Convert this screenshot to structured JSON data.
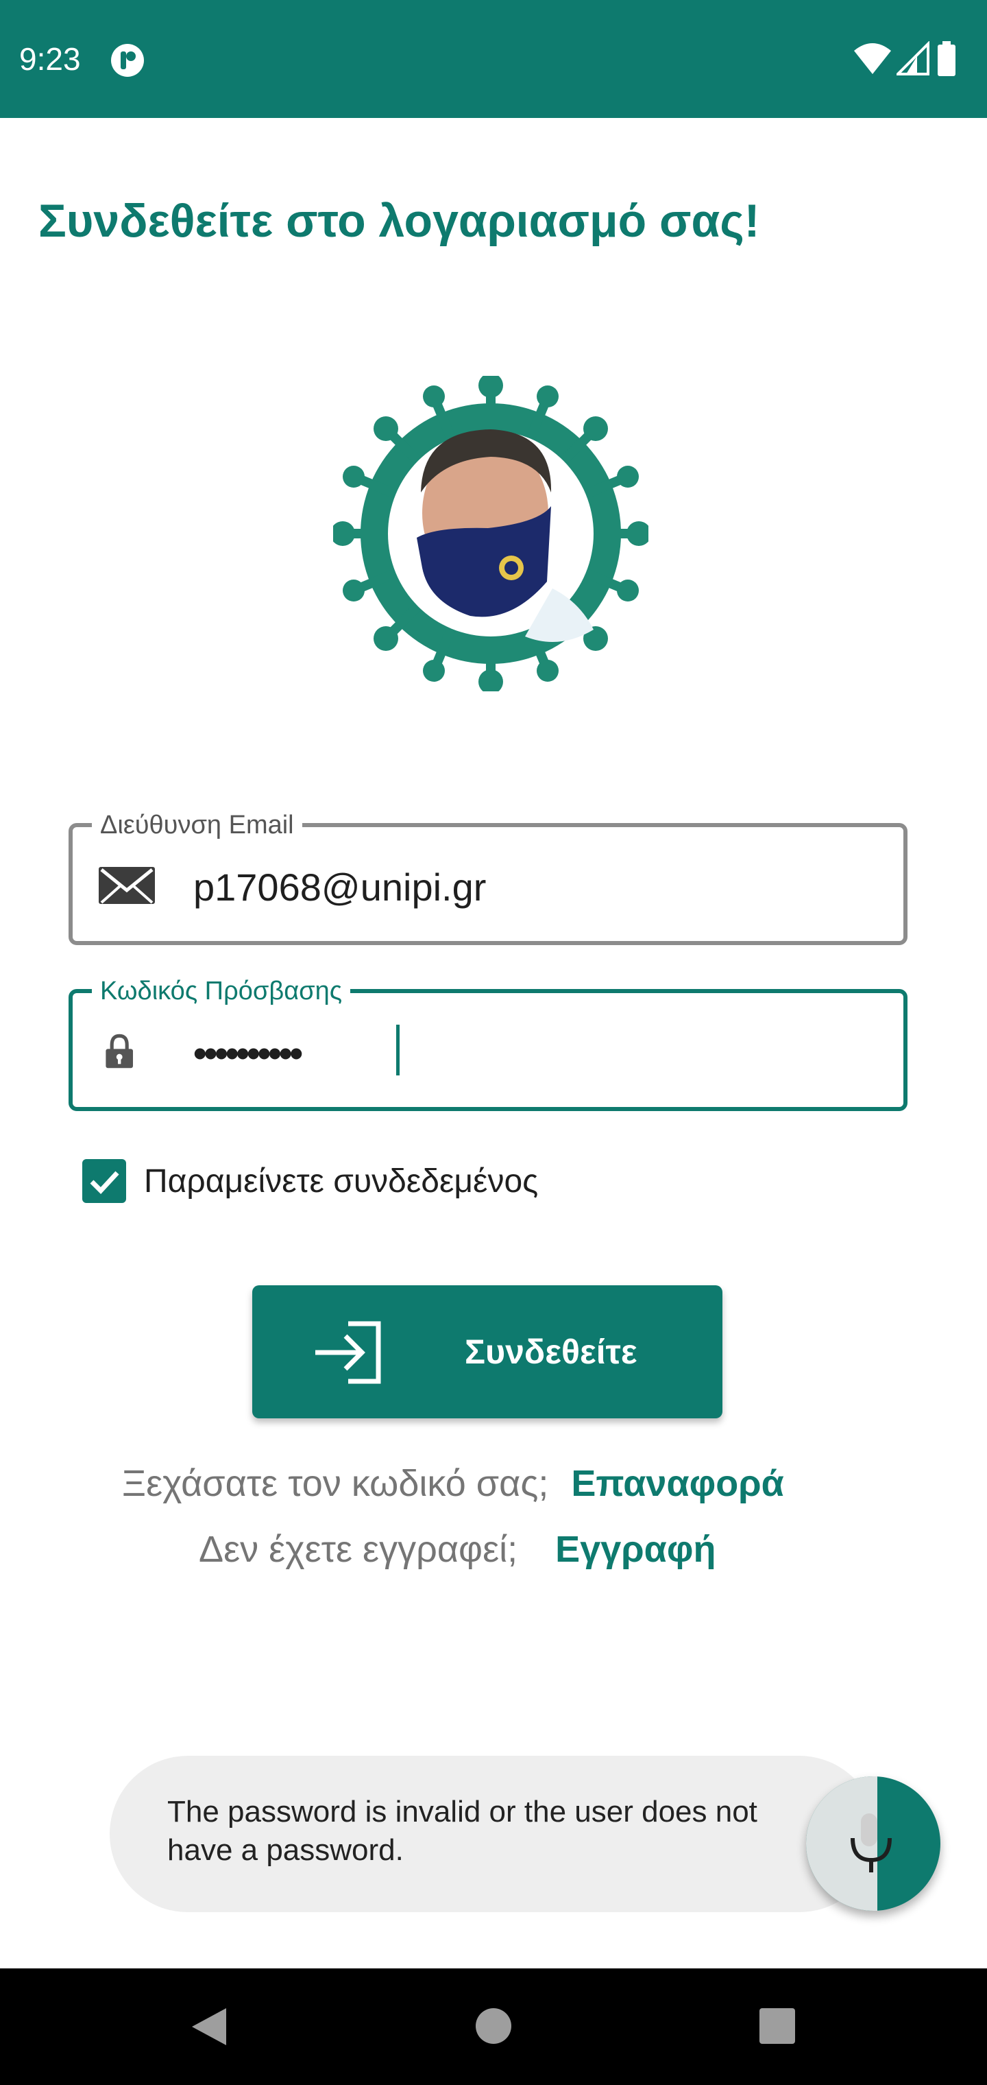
{
  "status_bar": {
    "time": "9:23",
    "icons": [
      "app-notification-icon",
      "wifi-icon",
      "cellular-signal-icon",
      "battery-icon"
    ]
  },
  "title": "Συνδεθείτε στο λογαριασμό σας!",
  "logo": {
    "description_icon": "coronavirus-avatar-logo"
  },
  "email_field": {
    "label": "Διεύθυνση Email",
    "value": "p17068@unipi.gr",
    "icon": "envelope-icon"
  },
  "password_field": {
    "label": "Κωδικός Πρόσβασης",
    "value": "••••••••••",
    "icon": "lock-icon"
  },
  "remember_me": {
    "label": "Παραμείνετε συνδεδεμένος",
    "checked": true
  },
  "login_button": {
    "label": "Συνδεθείτε",
    "icon": "login-arrow-icon"
  },
  "forgot": {
    "text": "Ξεχάσατε τον κωδικό σας;",
    "link": "Επαναφορά"
  },
  "signup": {
    "text": "Δεν έχετε εγγραφεί;",
    "link": "Εγγραφή"
  },
  "toast": {
    "message": "The password is invalid or the user does not have a password."
  },
  "fab": {
    "icon": "microphone-icon"
  },
  "colors": {
    "primary": "#0e7a6e",
    "muted_text": "#757575",
    "toast_bg": "#eeeeee"
  }
}
